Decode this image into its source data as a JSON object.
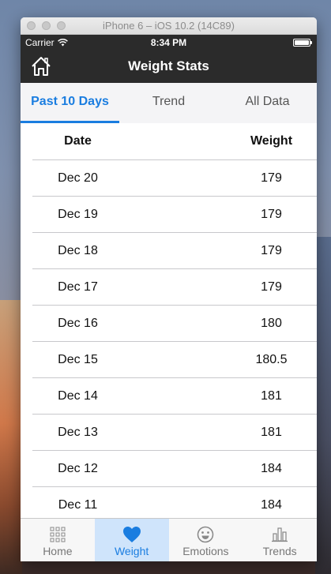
{
  "window": {
    "title": "iPhone 6 – iOS 10.2 (14C89)"
  },
  "status": {
    "carrier": "Carrier",
    "time": "8:34 PM",
    "battery_level": 1.0
  },
  "nav": {
    "title": "Weight Stats",
    "home_icon": "home-icon"
  },
  "tabs": [
    {
      "label": "Past 10 Days",
      "active": true
    },
    {
      "label": "Trend",
      "active": false
    },
    {
      "label": "All Data",
      "active": false
    }
  ],
  "table": {
    "headers": {
      "date": "Date",
      "weight": "Weight"
    },
    "rows": [
      {
        "date": "Dec 20",
        "weight": "179"
      },
      {
        "date": "Dec 19",
        "weight": "179"
      },
      {
        "date": "Dec 18",
        "weight": "179"
      },
      {
        "date": "Dec 17",
        "weight": "179"
      },
      {
        "date": "Dec 16",
        "weight": "180"
      },
      {
        "date": "Dec 15",
        "weight": "180.5"
      },
      {
        "date": "Dec 14",
        "weight": "181"
      },
      {
        "date": "Dec 13",
        "weight": "181"
      },
      {
        "date": "Dec 12",
        "weight": "184"
      },
      {
        "date": "Dec 11",
        "weight": "184"
      }
    ]
  },
  "tabbar": [
    {
      "label": "Home",
      "icon": "grid-icon",
      "active": false
    },
    {
      "label": "Weight",
      "icon": "heart-icon",
      "active": true
    },
    {
      "label": "Emotions",
      "icon": "smiley-icon",
      "active": false
    },
    {
      "label": "Trends",
      "icon": "bar-chart-icon",
      "active": false
    }
  ],
  "colors": {
    "accent": "#1a7de0",
    "nav_bg": "#2b2b2b",
    "active_tab_bg": "#cfe4fb"
  }
}
